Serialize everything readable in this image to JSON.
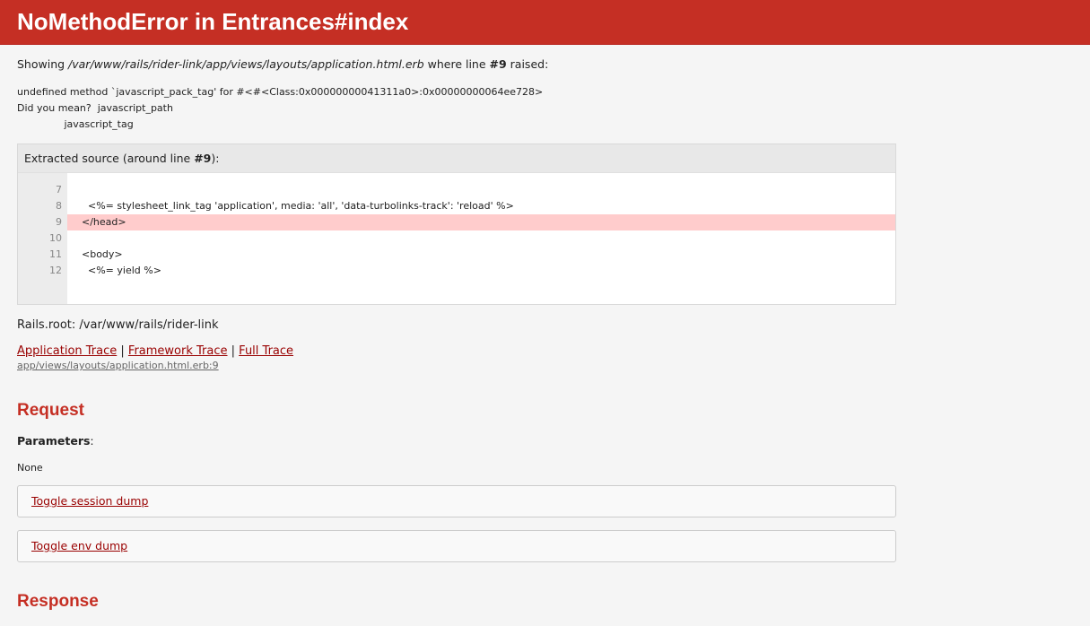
{
  "header": {
    "title": "NoMethodError in Entrances#index"
  },
  "showing": {
    "prefix": "Showing ",
    "path": "/var/www/rails/rider-link/app/views/layouts/application.html.erb",
    "middle": " where line ",
    "line": "#9",
    "suffix": " raised:"
  },
  "error_message": "undefined method `javascript_pack_tag' for #<#<Class:0x00000000041311a0>:0x00000000064ee728>\nDid you mean?  javascript_path\n               javascript_tag",
  "source": {
    "header_prefix": "Extracted source (around line ",
    "header_line": "#9",
    "header_suffix": "):",
    "lines": [
      {
        "num": "7",
        "code": ""
      },
      {
        "num": "8",
        "code": "  <%= stylesheet_link_tag 'application', media: 'all', 'data-turbolinks-track': 'reload' %>"
      },
      {
        "num": "9",
        "code": "</head>"
      },
      {
        "num": "10",
        "code": ""
      },
      {
        "num": "11",
        "code": "<body>"
      },
      {
        "num": "12",
        "code": "  <%= yield %>"
      }
    ],
    "highlight_line": "9"
  },
  "rails_root": "Rails.root: /var/www/rails/rider-link",
  "traces": {
    "application": "Application Trace",
    "separator": " | ",
    "framework": "Framework Trace",
    "full": "Full Trace",
    "app_trace_line": "app/views/layouts/application.html.erb:9"
  },
  "request": {
    "title": "Request",
    "parameters_label": "Parameters",
    "parameters_value": "None",
    "toggle_session": "Toggle session dump",
    "toggle_env": "Toggle env dump"
  },
  "response": {
    "title": "Response"
  },
  "colors": {
    "accent": "#c52f24",
    "highlight": "#ffcccc",
    "link": "#990000"
  }
}
